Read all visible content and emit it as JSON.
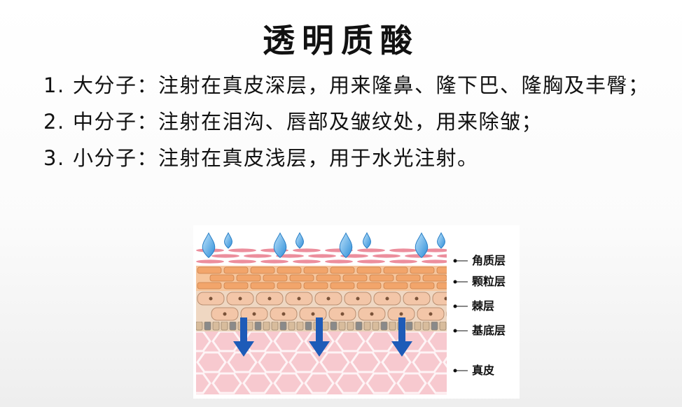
{
  "title": "透明质酸",
  "items": [
    {
      "num": "1.",
      "text": "大分子：注射在真皮深层，用来隆鼻、隆下巴、隆胸及丰臀；"
    },
    {
      "num": "2.",
      "text": "中分子：注射在泪沟、唇部及皱纹处，用来除皱；"
    },
    {
      "num": "3.",
      "text": "小分子：注射在真皮浅层，用于水光注射。"
    }
  ],
  "figure": {
    "layers": [
      "角质层",
      "颗粒层",
      "棘层",
      "基底层",
      "真皮"
    ],
    "colors": {
      "drop": "#5aaae6",
      "arrow": "#1e5bb8",
      "stratum_corneum": "#e97a8c",
      "granular": "#f2a56b",
      "spinous": "#f3c6a8",
      "basal": "#8a8a8a",
      "dermis": "#f7c9cf"
    }
  }
}
